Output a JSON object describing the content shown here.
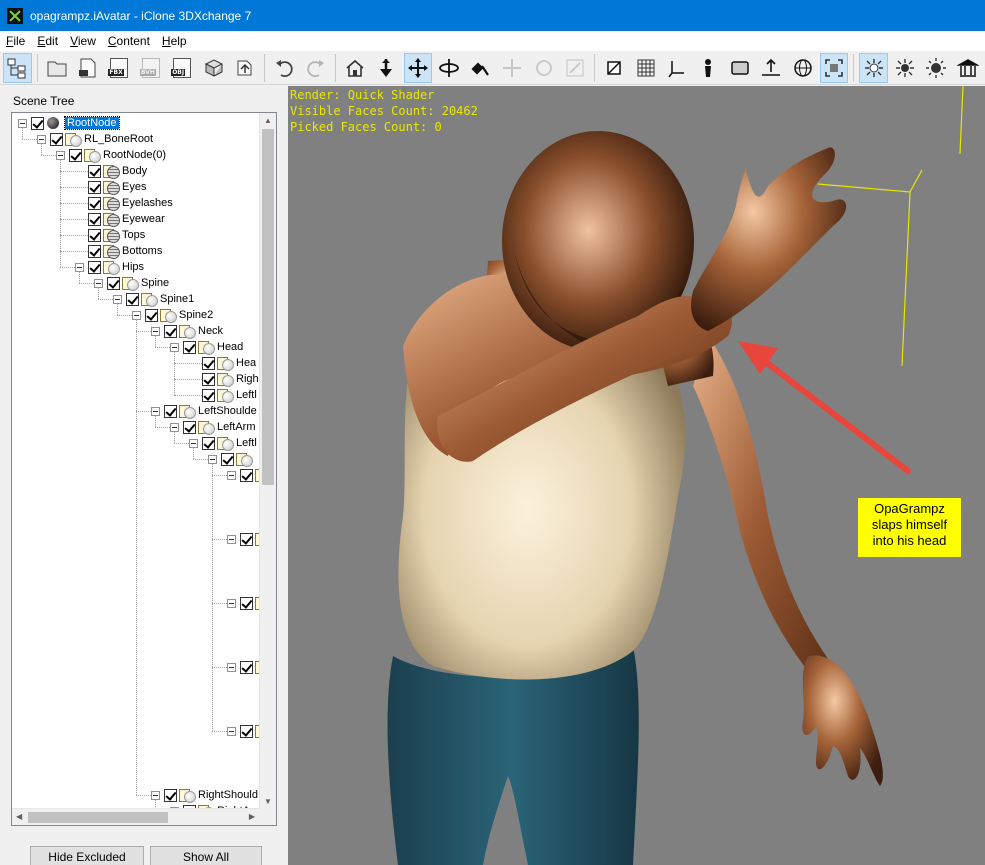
{
  "window": {
    "title": "opagrampz.iAvatar - iClone 3DXchange 7"
  },
  "menu": [
    {
      "key": "F",
      "rest": "ile"
    },
    {
      "key": "E",
      "rest": "dit"
    },
    {
      "key": "V",
      "rest": "iew"
    },
    {
      "key": "C",
      "rest": "ontent"
    },
    {
      "key": "H",
      "rest": "elp"
    }
  ],
  "toolbar": {
    "file_buttons": [
      "FBX",
      "BVH",
      "OBJ"
    ],
    "icons": [
      "scene-tree-icon",
      "open-folder-icon",
      "import-icon",
      "fbx-export-icon",
      "bvh-export-icon",
      "obj-export-icon",
      "package-icon",
      "convert-icon",
      "undo-icon",
      "redo-icon",
      "home-icon",
      "move-down-icon",
      "move-icon",
      "rotate-icon",
      "pick-icon",
      "transform-icon",
      "reset-icon",
      "scale-icon",
      "wire-icon",
      "grid-icon",
      "axis-icon",
      "bone-icon",
      "plane-icon",
      "ground-icon",
      "globe-icon",
      "frame-icon",
      "light-icon",
      "spot-light-icon",
      "sun-icon",
      "museum-icon"
    ]
  },
  "scene_tree": {
    "title": "Scene Tree",
    "nodes": [
      {
        "label": "RootNode",
        "depth": 0,
        "icon": "root",
        "selected": true
      },
      {
        "label": "RL_BoneRoot",
        "depth": 1,
        "icon": "bone"
      },
      {
        "label": "RootNode(0)",
        "depth": 2,
        "icon": "bone"
      },
      {
        "label": "Body",
        "depth": 3,
        "icon": "mesh",
        "leaf": true
      },
      {
        "label": "Eyes",
        "depth": 3,
        "icon": "mesh",
        "leaf": true
      },
      {
        "label": "Eyelashes",
        "depth": 3,
        "icon": "mesh",
        "leaf": true
      },
      {
        "label": "Eyewear",
        "depth": 3,
        "icon": "mesh",
        "leaf": true
      },
      {
        "label": "Tops",
        "depth": 3,
        "icon": "mesh",
        "leaf": true
      },
      {
        "label": "Bottoms",
        "depth": 3,
        "icon": "mesh",
        "leaf": true
      },
      {
        "label": "Hips",
        "depth": 3,
        "icon": "bone"
      },
      {
        "label": "Spine",
        "depth": 4,
        "icon": "bone"
      },
      {
        "label": "Spine1",
        "depth": 5,
        "icon": "bone"
      },
      {
        "label": "Spine2",
        "depth": 6,
        "icon": "bone"
      },
      {
        "label": "Neck",
        "depth": 7,
        "icon": "bone"
      },
      {
        "label": "Head",
        "depth": 8,
        "icon": "bone"
      },
      {
        "label": "Hea",
        "depth": 9,
        "icon": "bone",
        "leaf": true
      },
      {
        "label": "Righ",
        "depth": 9,
        "icon": "bone",
        "leaf": true
      },
      {
        "label": "Leftl",
        "depth": 9,
        "icon": "bone",
        "leaf": true
      },
      {
        "label": "LeftShoulde",
        "depth": 7,
        "icon": "bone"
      },
      {
        "label": "LeftArm",
        "depth": 8,
        "icon": "bone"
      },
      {
        "label": "Leftl",
        "depth": 9,
        "icon": "bone"
      },
      {
        "label": "",
        "depth": 10,
        "icon": "bone"
      },
      {
        "label": "",
        "depth": 11,
        "icon": "bone",
        "row": 22
      },
      {
        "label": "",
        "depth": 11,
        "icon": "bone",
        "row": 26
      },
      {
        "label": "",
        "depth": 11,
        "icon": "bone",
        "row": 30
      },
      {
        "label": "",
        "depth": 11,
        "icon": "bone",
        "row": 34
      },
      {
        "label": "",
        "depth": 11,
        "icon": "bone",
        "row": 38
      },
      {
        "label": "RightShould",
        "depth": 7,
        "icon": "bone",
        "row": 42
      },
      {
        "label": "RightArm",
        "depth": 8,
        "icon": "bone",
        "row": 43
      }
    ]
  },
  "buttons": {
    "hide_excluded": "Hide Excluded",
    "show_all": "Show All"
  },
  "viewport": {
    "render": "Render: Quick Shader",
    "visible_faces": "Visible Faces Count: 20462",
    "picked_faces": "Picked Faces Count: 0",
    "callout_lines": [
      "OpaGrampz",
      "slaps himself",
      "into his head"
    ]
  },
  "colors": {
    "titlebar": "#0078d7",
    "info_text": "#e8e800",
    "callout_bg": "#ffff00",
    "arrow": "#e8453c",
    "viewport_bg": "#808080"
  }
}
